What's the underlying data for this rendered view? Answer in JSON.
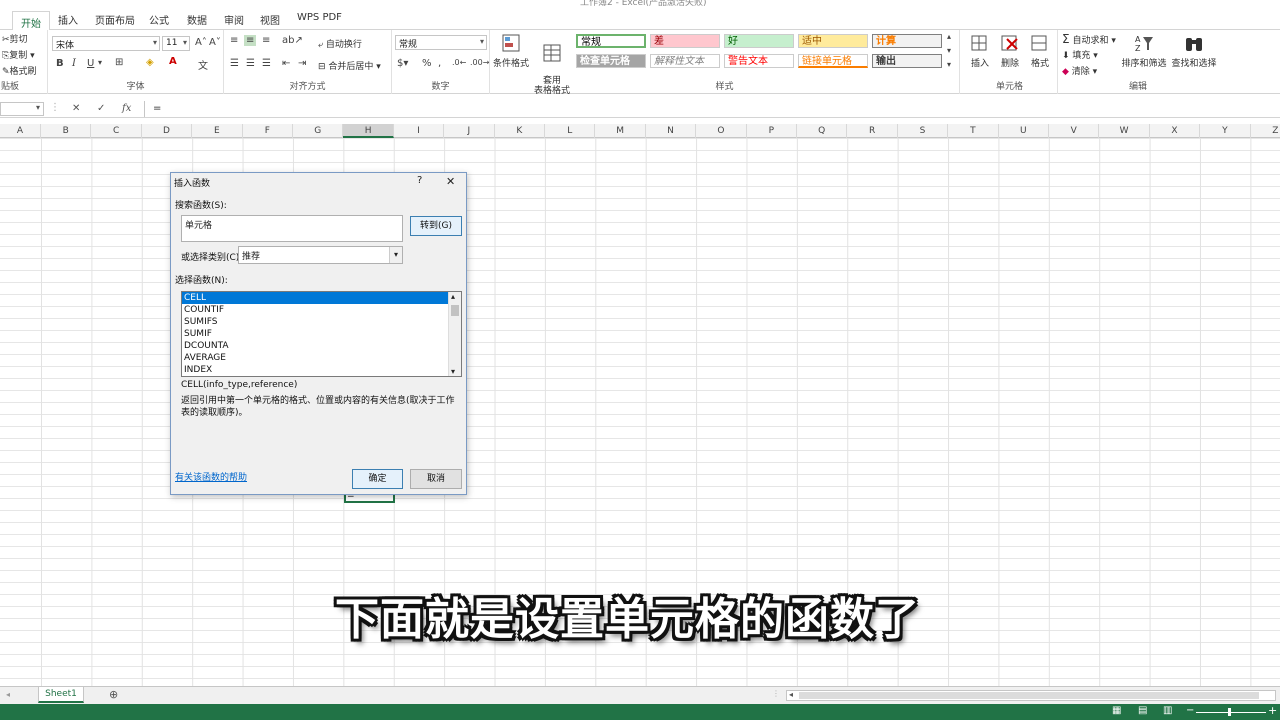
{
  "window": {
    "title": "工作簿2 - Excel(产品激活失败)"
  },
  "tabs": [
    "开始",
    "插入",
    "页面布局",
    "公式",
    "数据",
    "审阅",
    "视图",
    "WPS PDF"
  ],
  "clipboard": {
    "cut": "剪切",
    "copy": "复制",
    "format_painter": "格式刷",
    "label": "贴板"
  },
  "font": {
    "name": "宋体",
    "size": "11",
    "bold": "B",
    "italic": "I",
    "underline": "U",
    "label": "字体"
  },
  "alignment": {
    "wrap": "自动换行",
    "merge": "合并后居中",
    "label": "对齐方式"
  },
  "number": {
    "format": "常规",
    "label": "数字"
  },
  "styles": {
    "conditional": "条件格式",
    "table": "套用\n表格格式",
    "cells": [
      {
        "text": "常规",
        "bg": "#ffffff",
        "fg": "#000000"
      },
      {
        "text": "差",
        "bg": "#ffc7ce",
        "fg": "#9c0006"
      },
      {
        "text": "好",
        "bg": "#c6efce",
        "fg": "#006100"
      },
      {
        "text": "适中",
        "bg": "#ffeb9c",
        "fg": "#9c5700"
      },
      {
        "text": "计算",
        "bg": "#f2f2f2",
        "fg": "#fa7d00"
      },
      {
        "text": "检查单元格",
        "bg": "#a5a5a5",
        "fg": "#ffffff"
      },
      {
        "text": "解释性文本",
        "bg": "#ffffff",
        "fg": "#7f7f7f"
      },
      {
        "text": "警告文本",
        "bg": "#ffffff",
        "fg": "#ff0000"
      },
      {
        "text": "链接单元格",
        "bg": "#ffffff",
        "fg": "#fa7d00"
      },
      {
        "text": "输出",
        "bg": "#f2f2f2",
        "fg": "#3f3f3f"
      }
    ],
    "label": "样式"
  },
  "cells_group": {
    "insert": "插入",
    "delete": "删除",
    "format": "格式",
    "label": "单元格"
  },
  "editing": {
    "autosum": "自动求和",
    "fill": "填充",
    "clear": "清除",
    "sort": "排序和筛选",
    "find": "查找和选择",
    "label": "编辑"
  },
  "formula_bar": {
    "cancel": "✕",
    "enter": "✓",
    "fx": "fx",
    "content": "="
  },
  "columns": [
    "A",
    "B",
    "C",
    "D",
    "E",
    "F",
    "G",
    "H",
    "I",
    "J",
    "K",
    "L",
    "M",
    "N",
    "O",
    "P",
    "Q",
    "R",
    "S",
    "T",
    "U",
    "V",
    "W",
    "X",
    "Y",
    "Z"
  ],
  "active_cell_value": "=",
  "dialog": {
    "title": "插入函数",
    "help_glyph": "?",
    "close_glyph": "✕",
    "search_label": "搜索函数(S):",
    "search_value": "单元格",
    "go_button": "转到(G)",
    "category_label": "或选择类别(C):",
    "category_value": "推荐",
    "select_label": "选择函数(N):",
    "functions": [
      "CELL",
      "COUNTIF",
      "SUMIFS",
      "SUMIF",
      "DCOUNTA",
      "AVERAGE",
      "INDEX"
    ],
    "signature": "CELL(info_type,reference)",
    "description": "返回引用中第一个单元格的格式、位置或内容的有关信息(取决于工作表的读取顺序)。",
    "help_link": "有关该函数的帮助",
    "ok": "确定",
    "cancel": "取消"
  },
  "subtitle": "下面就是设置单元格的函数了",
  "sheet": {
    "tab": "Sheet1",
    "add": "⊕"
  }
}
